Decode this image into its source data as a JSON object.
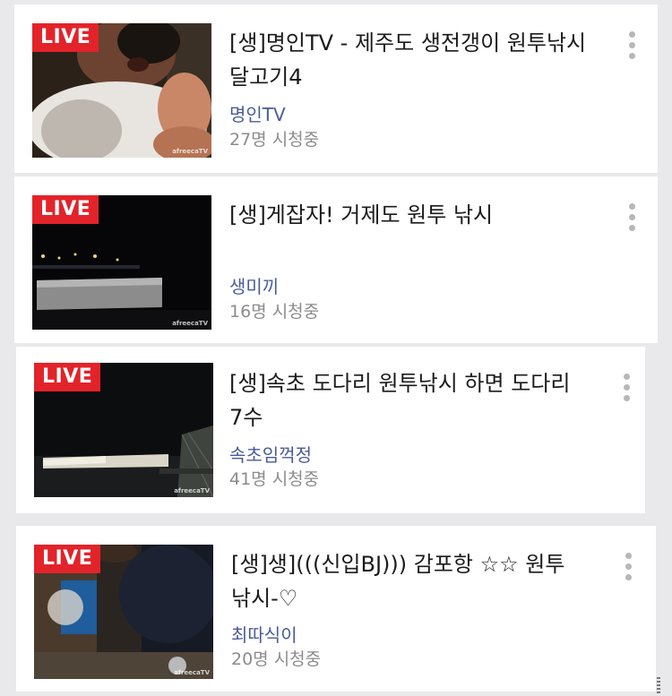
{
  "badge": {
    "live_label": "LIVE"
  },
  "streams": [
    {
      "title": "[생]명인TV - 제주도 생전갱이 원투낚시 달고기4",
      "channel": "명인TV",
      "viewers": "27명 시청중",
      "watermark": "afreecaTV"
    },
    {
      "title": "[생]게잡자! 거제도 원투 낚시",
      "channel": "생미끼",
      "viewers": "16명 시청중",
      "watermark": "afreecaTV"
    },
    {
      "title": "[생]속초 도다리 원투낚시 하면 도다리 7수",
      "channel": "속초임꺽정",
      "viewers": "41명 시청중",
      "watermark": "afreecaTV"
    },
    {
      "title": "[생]생](((신입BJ))) 감포항 ☆☆ 원투 낚시-♡",
      "channel": "최따식이",
      "viewers": "20명 시청중",
      "watermark": "afreecaTV"
    }
  ],
  "colors": {
    "live_badge": "#e3232a",
    "channel_text": "#4a5b97",
    "viewer_text": "#8c8c8c",
    "background": "#e9e9ec"
  },
  "icons": {
    "more": "vertical-ellipsis-icon"
  }
}
